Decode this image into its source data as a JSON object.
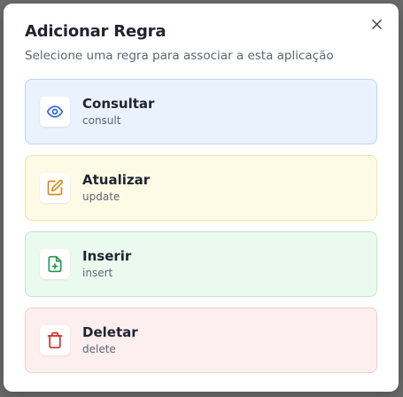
{
  "modal": {
    "title": "Adicionar Regra",
    "subtitle": "Selecione uma regra para associar a esta aplicação"
  },
  "rules": [
    {
      "name": "Consultar",
      "code": "consult",
      "icon": "eye-icon",
      "color": "#2b63d9"
    },
    {
      "name": "Atualizar",
      "code": "update",
      "icon": "edit-icon",
      "color": "#d98a16"
    },
    {
      "name": "Inserir",
      "code": "insert",
      "icon": "file-plus-icon",
      "color": "#1f9a4e"
    },
    {
      "name": "Deletar",
      "code": "delete",
      "icon": "trash-icon",
      "color": "#d42a2a"
    }
  ]
}
